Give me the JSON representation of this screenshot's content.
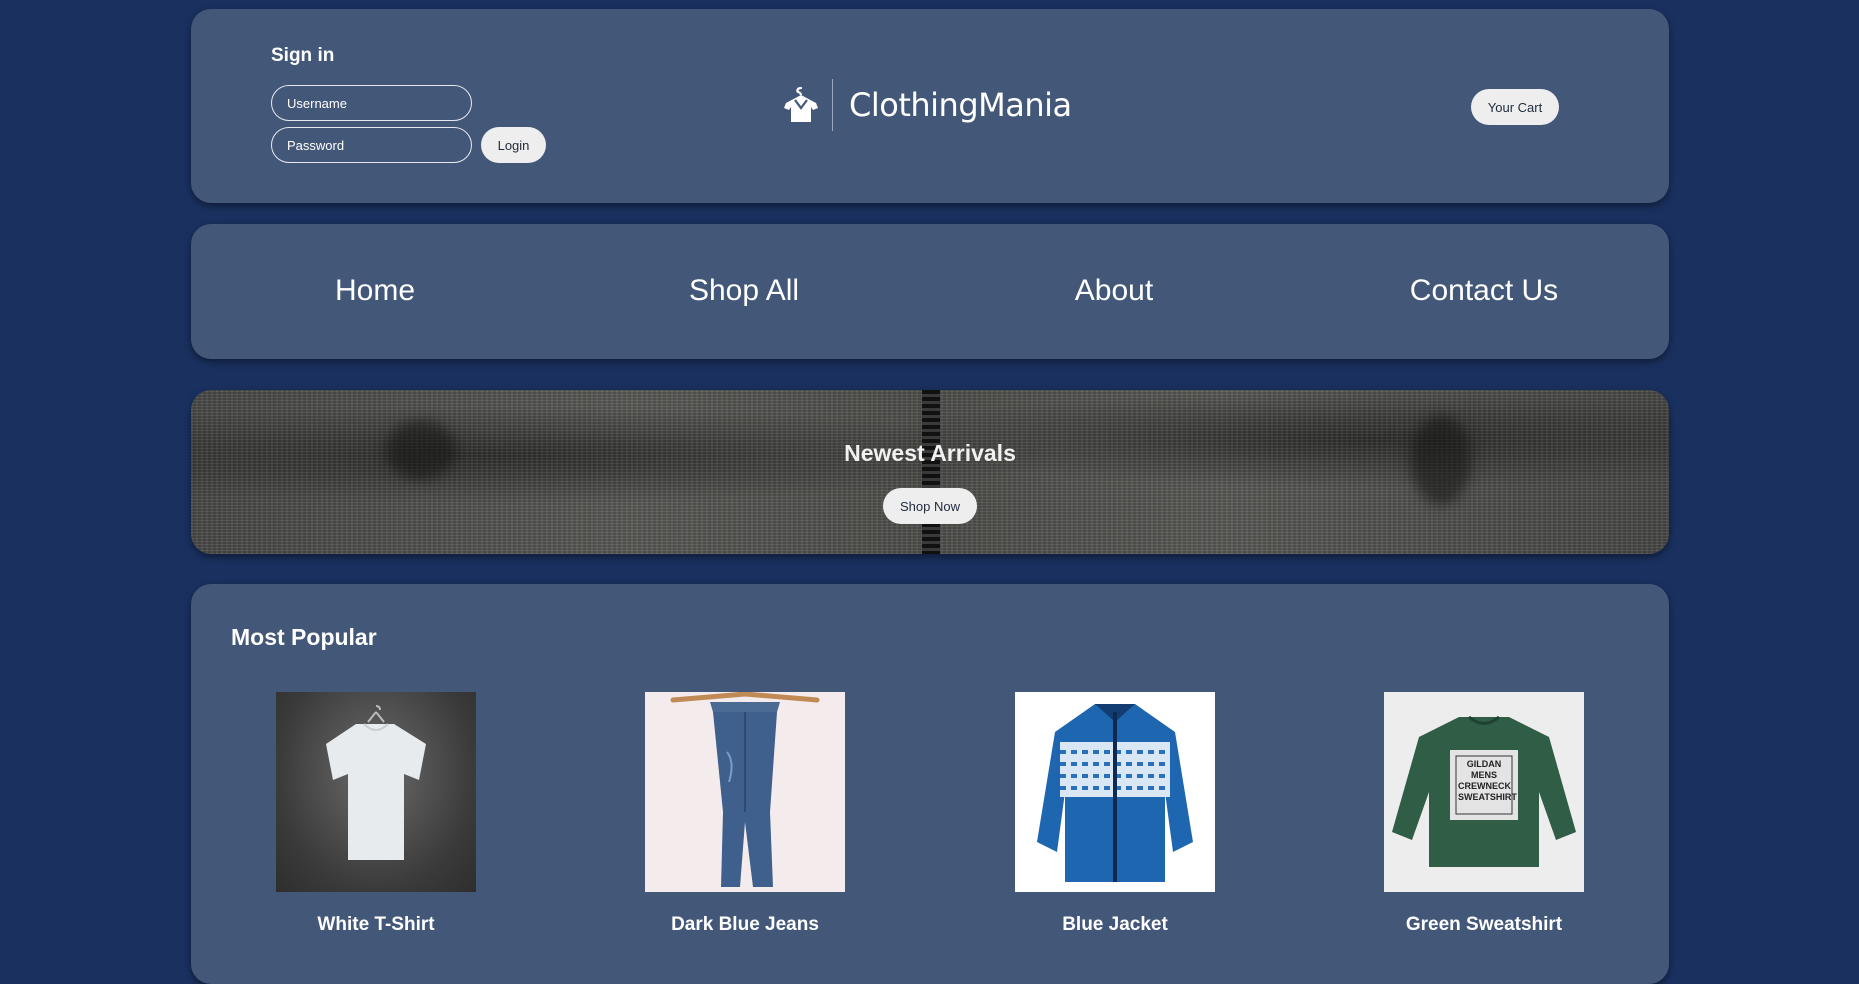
{
  "header": {
    "signin_title": "Sign in",
    "username_placeholder": "Username",
    "password_placeholder": "Password",
    "login_label": "Login",
    "brand_name": "ClothingMania",
    "cart_label": "Your Cart"
  },
  "nav": {
    "items": [
      {
        "label": "Home"
      },
      {
        "label": "Shop All"
      },
      {
        "label": "About"
      },
      {
        "label": "Contact Us"
      }
    ]
  },
  "banner": {
    "title": "Newest Arrivals",
    "button_label": "Shop Now"
  },
  "popular": {
    "title": "Most Popular",
    "products": [
      {
        "name": "White T-Shirt",
        "icon": "white-tshirt-image"
      },
      {
        "name": "Dark Blue Jeans",
        "icon": "dark-blue-jeans-image"
      },
      {
        "name": "Blue Jacket",
        "icon": "blue-jacket-image"
      },
      {
        "name": "Green Sweatshirt",
        "icon": "green-sweatshirt-image"
      }
    ],
    "sweatshirt_print": "GILDAN MENS CREWNECK SWEATSHIRT"
  },
  "colors": {
    "page_background": "#1a3160",
    "card_background": "#435778",
    "button_background": "#eeeeee"
  }
}
